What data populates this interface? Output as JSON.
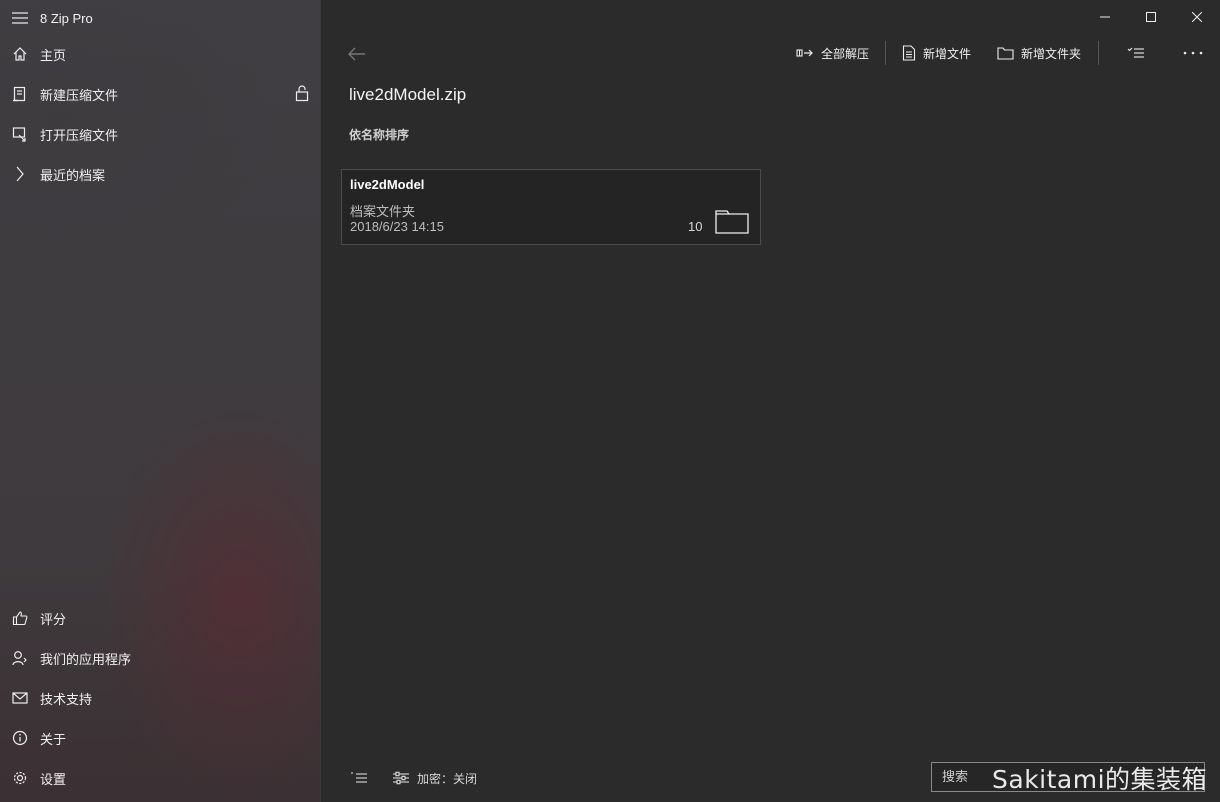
{
  "app": {
    "title": "8 Zip Pro"
  },
  "sidebar": {
    "items": [
      {
        "label": "主页",
        "icon": "home-icon"
      },
      {
        "label": "新建压缩文件",
        "icon": "new-archive-icon"
      },
      {
        "label": "打开压缩文件",
        "icon": "open-archive-icon"
      },
      {
        "label": "最近的档案",
        "icon": "chevron-right-icon"
      }
    ],
    "bottom_items": [
      {
        "label": "评分",
        "icon": "thumbs-up-icon"
      },
      {
        "label": "我们的应用程序",
        "icon": "person-icon"
      },
      {
        "label": "技术支持",
        "icon": "mail-icon"
      },
      {
        "label": "关于",
        "icon": "info-icon"
      },
      {
        "label": "设置",
        "icon": "gear-icon"
      }
    ]
  },
  "toolbar": {
    "extract_all": "全部解压",
    "new_file": "新增文件",
    "new_folder": "新增文件夹"
  },
  "main": {
    "title": "live2dModel.zip",
    "sort_label": "依名称排序",
    "items": [
      {
        "name": "live2dModel",
        "type": "档案文件夹",
        "date": "2018/6/23 14:15",
        "count": "10"
      }
    ]
  },
  "bottom": {
    "encrypt_label": "加密：关闭",
    "search_placeholder": "搜索"
  },
  "watermark": "Sakitami的集装箱",
  "colors": {
    "background": "#2b2b2b",
    "sidebar": "#3f3c40",
    "card": "#242424",
    "accent_text": "#ffffff"
  }
}
